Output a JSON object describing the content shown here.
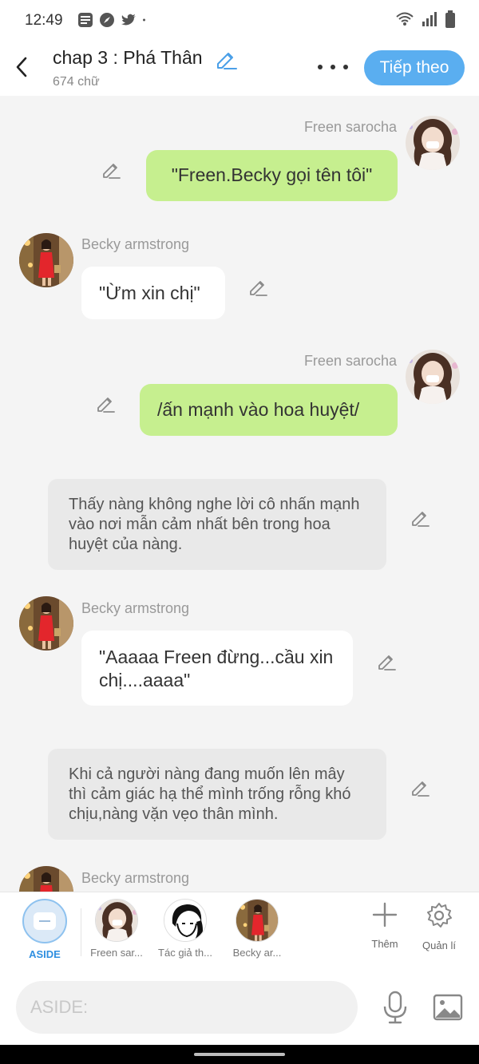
{
  "status_bar": {
    "time": "12:49"
  },
  "header": {
    "title": "chap 3 : Phá Thân",
    "word_count": "674 chữ",
    "next_label": "Tiếp theo"
  },
  "messages": [
    {
      "type": "right",
      "name": "Freen sarocha",
      "text": "\"Freen.Becky gọi tên tôi\""
    },
    {
      "type": "left",
      "name": "Becky armstrong",
      "text": "\"Ừm xin chị\""
    },
    {
      "type": "right",
      "name": "Freen sarocha",
      "text": "/ấn mạnh vào hoa huyệt/"
    },
    {
      "type": "narration",
      "text": "Thấy nàng không nghe lời cô nhấn mạnh vào nơi mẫn cảm nhất bên trong hoa huyệt của nàng."
    },
    {
      "type": "left",
      "name": "Becky armstrong",
      "text": "\"Aaaaa Freen đừng...cầu xin chị....aaaa\""
    },
    {
      "type": "narration",
      "text": "Khi cả người nàng đang muốn lên mây thì cảm giác hạ thể mình trống rỗng khó chịu,nàng vặn vẹo thân mình."
    },
    {
      "type": "left",
      "name": "Becky armstrong",
      "text": ""
    }
  ],
  "tabs": [
    {
      "label": "ASIDE"
    },
    {
      "label": "Freen sar..."
    },
    {
      "label": "Tác giả th..."
    },
    {
      "label": "Becky ar..."
    }
  ],
  "tools": {
    "add_label": "Thêm",
    "manage_label": "Quản lí"
  },
  "composer": {
    "placeholder": "ASIDE:"
  },
  "colors": {
    "accent": "#5aaef0",
    "right_bubble": "#c6ef8f",
    "narration_bubble": "#e9e9e9",
    "aside_label": "#2f8fe0"
  }
}
